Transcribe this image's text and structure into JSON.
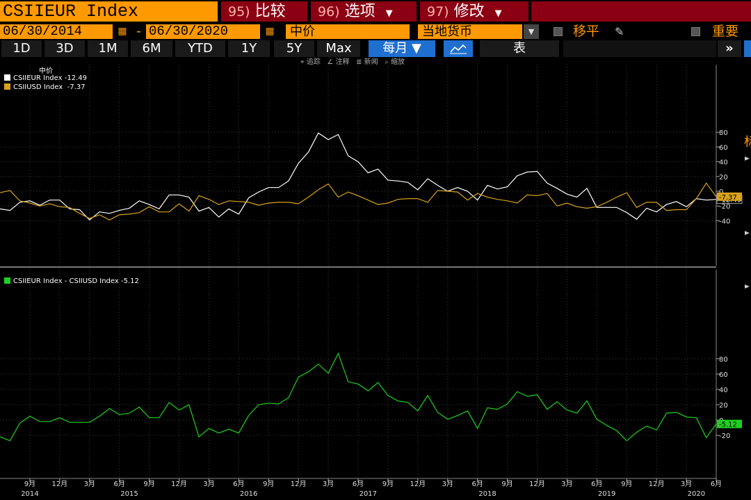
{
  "header": {
    "ticker": "CSIIEUR Index",
    "buttons": [
      {
        "num": "95)",
        "label": "比较"
      },
      {
        "num": "96)",
        "label": "选项"
      },
      {
        "num": "97)",
        "label": "修改"
      }
    ]
  },
  "controls": {
    "start_date": "06/30/2014",
    "end_date": "06/30/2020",
    "dash": "-",
    "price_field": "中价",
    "currency": "当地货币",
    "shift_label": "移平",
    "important_label": "重要",
    "right_edge_label": "标"
  },
  "periods": [
    "1D",
    "3D",
    "1M",
    "6M",
    "YTD",
    "1Y",
    "5Y",
    "Max"
  ],
  "frequency": "每月",
  "table_label": "表",
  "more_label": "»",
  "toolbar": [
    "追踪",
    "注释",
    "新闻",
    "缩放"
  ],
  "colors": {
    "eur": "#ffffff",
    "usd": "#d9a21c",
    "diff": "#1fd11f",
    "accent": "#ff9900"
  },
  "chart_data": [
    {
      "type": "line",
      "panel_label": "中价",
      "series": [
        {
          "name": "CSIIEUR Index",
          "last_label": "-12.49",
          "values": [
            -24,
            -26,
            -15,
            -13,
            -19,
            -12,
            -12,
            -24,
            -25,
            -39,
            -28,
            -30,
            -26,
            -23,
            -13,
            -18,
            -24,
            -5,
            -5,
            -8,
            -27,
            -22,
            -35,
            -24,
            -31,
            -9,
            -1,
            5,
            5,
            14,
            38,
            53,
            79,
            70,
            77,
            48,
            40,
            25,
            30,
            15,
            14,
            12,
            2,
            17,
            8,
            0,
            5,
            0,
            -12,
            8,
            3,
            6,
            21,
            26,
            27,
            11,
            4,
            -4,
            -8,
            4,
            -22,
            -22,
            -22,
            -29,
            -38,
            -23,
            -28,
            -18,
            -14,
            -21,
            -10,
            -12,
            -11
          ]
        },
        {
          "name": "CSIIUSD Index",
          "last_label": "-7.37",
          "values": [
            -2,
            1,
            -13,
            -16,
            -20,
            -17,
            -21,
            -22,
            -30,
            -37,
            -32,
            -39,
            -32,
            -31,
            -29,
            -21,
            -28,
            -28,
            -17,
            -27,
            -6,
            -11,
            -18,
            -13,
            -14,
            -15,
            -19,
            -16,
            -15,
            -15,
            -17,
            -8,
            2,
            10,
            -8,
            -1,
            -6,
            -12,
            -18,
            -16,
            -11,
            -10,
            -10,
            -15,
            1,
            0,
            -1,
            -12,
            -3,
            -8,
            -11,
            -13,
            -16,
            -5,
            -6,
            -3,
            -20,
            -16,
            -21,
            -23,
            -21,
            -15,
            -8,
            -2,
            -22,
            -15,
            -15,
            -26,
            -25,
            -25,
            -10,
            11,
            -7.37
          ]
        }
      ],
      "ylim": [
        -50,
        85
      ],
      "yticks": [
        80,
        60,
        40,
        20,
        0,
        -20,
        -40
      ]
    },
    {
      "type": "line",
      "series": [
        {
          "name": "CSIIEUR Index - CSIIUSD Index",
          "last_label": "-5.12",
          "values": [
            -22,
            -27,
            -4,
            5,
            -2,
            -2,
            3,
            -3,
            -3,
            -3,
            5,
            15,
            7,
            9,
            17,
            3,
            3,
            23,
            13,
            20,
            -22,
            -11,
            -17,
            -12,
            -17,
            6,
            20,
            22,
            21,
            29,
            56,
            63,
            73,
            61,
            87,
            50,
            47,
            38,
            49,
            32,
            25,
            23,
            12,
            32,
            10,
            1,
            6,
            12,
            -11,
            16,
            14,
            21,
            37,
            31,
            33,
            14,
            24,
            13,
            9,
            25,
            1,
            -7,
            -14,
            -27,
            -16,
            -8,
            -13,
            9,
            10,
            4,
            3,
            -23,
            -5.12
          ]
        }
      ],
      "ylim": [
        -32,
        97
      ],
      "yticks": [
        80,
        60,
        40,
        20,
        0,
        -20
      ]
    }
  ],
  "x_axis": {
    "month_ticks": [
      {
        "i": 3,
        "label": "9月"
      },
      {
        "i": 6,
        "label": "12月"
      },
      {
        "i": 9,
        "label": "3月"
      },
      {
        "i": 12,
        "label": "6月"
      },
      {
        "i": 15,
        "label": "9月"
      },
      {
        "i": 18,
        "label": "12月"
      },
      {
        "i": 21,
        "label": "3月"
      },
      {
        "i": 24,
        "label": "6月"
      },
      {
        "i": 27,
        "label": "9月"
      },
      {
        "i": 30,
        "label": "12月"
      },
      {
        "i": 33,
        "label": "3月"
      },
      {
        "i": 36,
        "label": "6月"
      },
      {
        "i": 39,
        "label": "9月"
      },
      {
        "i": 42,
        "label": "12月"
      },
      {
        "i": 45,
        "label": "3月"
      },
      {
        "i": 48,
        "label": "6月"
      },
      {
        "i": 51,
        "label": "9月"
      },
      {
        "i": 54,
        "label": "12月"
      },
      {
        "i": 57,
        "label": "3月"
      },
      {
        "i": 60,
        "label": "6月"
      },
      {
        "i": 63,
        "label": "9月"
      },
      {
        "i": 66,
        "label": "12月"
      },
      {
        "i": 69,
        "label": "3月"
      },
      {
        "i": 72,
        "label": "6月"
      }
    ],
    "year_ticks": [
      {
        "i": 3,
        "label": "2014"
      },
      {
        "i": 13,
        "label": "2015"
      },
      {
        "i": 25,
        "label": "2016"
      },
      {
        "i": 37,
        "label": "2017"
      },
      {
        "i": 49,
        "label": "2018"
      },
      {
        "i": 61,
        "label": "2019"
      },
      {
        "i": 70,
        "label": "2020"
      }
    ]
  }
}
